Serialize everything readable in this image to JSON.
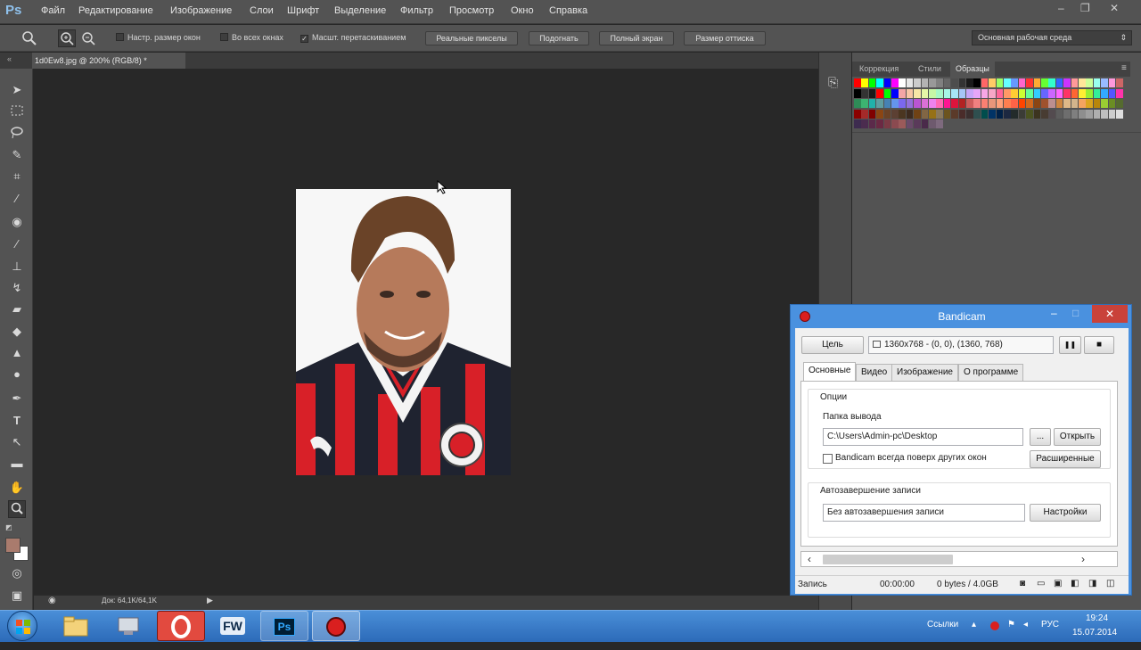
{
  "app": {
    "logo": "Ps"
  },
  "menu": [
    "Файл",
    "Редактирование",
    "Изображение",
    "Слои",
    "Шрифт",
    "Выделение",
    "Фильтр",
    "Просмотр",
    "Окно",
    "Справка"
  ],
  "window_controls": {
    "minimize": "–",
    "restore": "❐",
    "close": "✕"
  },
  "options_bar": {
    "checkbox_fit_windows": "Настр. размер окон",
    "checkbox_all_windows": "Во всех окнах",
    "checkbox_scrubby_zoom": "Масшт. перетаскиванием",
    "actual_pixels": "Реальные пикселы",
    "fit_screen": "Подогнать",
    "fill_screen": "Полный экран",
    "print_size": "Размер оттиска",
    "workspace": "Основная рабочая среда"
  },
  "document": {
    "tab_title": "1d0Ew8.jpg @ 200% (RGB/8) *",
    "doc_size": "Док: 64,1K/64,1K"
  },
  "panels": {
    "tabs": [
      "Коррекция",
      "Стили",
      "Образцы"
    ],
    "active_tab": "Образцы",
    "swatch_rows": [
      [
        "#ff0000",
        "#ffff00",
        "#00ff00",
        "#00ffff",
        "#0000ff",
        "#ff00ff",
        "#ffffff",
        "#e6e6e6",
        "#cccccc",
        "#b3b3b3",
        "#999999",
        "#808080",
        "#666666",
        "#4d4d4d",
        "#333333",
        "#1a1a1a",
        "#000000",
        "#ff6666",
        "#ffcc66",
        "#99ff66",
        "#66ffff",
        "#6699ff",
        "#ff66cc",
        "#ff3333",
        "#ffaa33",
        "#66ff33",
        "#33ffcc",
        "#3366ff",
        "#cc33ff",
        "#ff9999",
        "#ffe699",
        "#ccff99",
        "#99ffee",
        "#99bbff",
        "#ff99dd",
        "#cc6666"
      ],
      [
        "#000000",
        "#333333",
        "#1a1a1a",
        "#ff0000",
        "#00ff00",
        "#0000ff",
        "#f4a6a6",
        "#f7c6a6",
        "#f7e6a6",
        "#e6f7a6",
        "#c6f7a6",
        "#a6f7c6",
        "#a6f7e6",
        "#a6e6f7",
        "#a6c6f7",
        "#c6a6f7",
        "#e6a6f7",
        "#f7a6e6",
        "#f7a6c6",
        "#ff6699",
        "#ff9966",
        "#ffcc33",
        "#ccff33",
        "#66ff99",
        "#33ccff",
        "#6666ff",
        "#cc66ff",
        "#ff66ff",
        "#ff3366",
        "#ff6633",
        "#ffee33",
        "#99ee33",
        "#33ee99",
        "#33aaff",
        "#5555ff",
        "#ff33aa"
      ],
      [
        "#2e8b57",
        "#3cb371",
        "#20b2aa",
        "#5f9ea0",
        "#4682b4",
        "#6495ed",
        "#7b68ee",
        "#9370db",
        "#ba55d3",
        "#da70d6",
        "#ee82ee",
        "#ff69b4",
        "#ff1493",
        "#dc143c",
        "#b22222",
        "#cd5c5c",
        "#f08080",
        "#fa8072",
        "#e9967a",
        "#ffa07a",
        "#ff7f50",
        "#ff6347",
        "#ff4500",
        "#d2691e",
        "#8b4513",
        "#a0522d",
        "#bc8f8f",
        "#cd853f",
        "#deb887",
        "#d2b48c",
        "#f4a460",
        "#daa520",
        "#b8860b",
        "#9acd32",
        "#6b8e23",
        "#556b2f"
      ],
      [
        "#8b0000",
        "#a52a2a",
        "#800000",
        "#8b4513",
        "#6b4226",
        "#5c4033",
        "#4b3621",
        "#3d2b1f",
        "#704214",
        "#826644",
        "#967117",
        "#8a795d",
        "#6c541e",
        "#5b3a29",
        "#4a2c2a",
        "#3b2f2f",
        "#2f4f4f",
        "#004d4d",
        "#003366",
        "#002147",
        "#1c2841",
        "#232b2b",
        "#3b3c36",
        "#4b5320",
        "#3c341f",
        "#483c32",
        "#534b4f",
        "#5d5d5d",
        "#6e6e6e",
        "#7f7f7f",
        "#8e8e8e",
        "#9f9f9f",
        "#aeaeae",
        "#bfbfbf",
        "#cecece",
        "#dfdfdf"
      ],
      [
        "#3d2b4f",
        "#4b2c4f",
        "#5b2a4a",
        "#6b2943",
        "#7b3a45",
        "#8b4a50",
        "#9b5a5a",
        "#6a4a6a",
        "#5a3a5a",
        "#4a2a4a",
        "#6e5a6e",
        "#7e6a7e"
      ]
    ]
  },
  "bandicam": {
    "title": "Bandicam",
    "target_button": "Цель",
    "target_info": "1360x768 - (0, 0), (1360, 768)",
    "pause_label": "❚❚",
    "stop_label": "■",
    "tabs": [
      "Основные",
      "Видео",
      "Изображение",
      "О программе"
    ],
    "active_tab": "Основные",
    "options_group": "Опции",
    "output_folder_label": "Папка вывода",
    "output_folder_value": "C:\\Users\\Admin-pc\\Desktop",
    "browse_button": "...",
    "open_button": "Открыть",
    "always_on_top": "Bandicam всегда поверх других окон",
    "advanced_button": "Расширенные",
    "autocomplete_group": "Автозавершение записи",
    "autocomplete_value": "Без автозавершения записи",
    "settings_button": "Настройки",
    "status": {
      "state": "Запись",
      "time": "00:00:00",
      "size": "0 bytes / 4.0GB"
    }
  },
  "taskbar": {
    "apps": [
      "start-orb",
      "explorer",
      "network",
      "opera",
      "fw",
      "photoshop",
      "bandicam"
    ],
    "fw_label": "FW",
    "ps_label": "Ps",
    "links_label": "Ссылки",
    "language": "РУС",
    "time": "19:24",
    "date": "15.07.2014"
  }
}
